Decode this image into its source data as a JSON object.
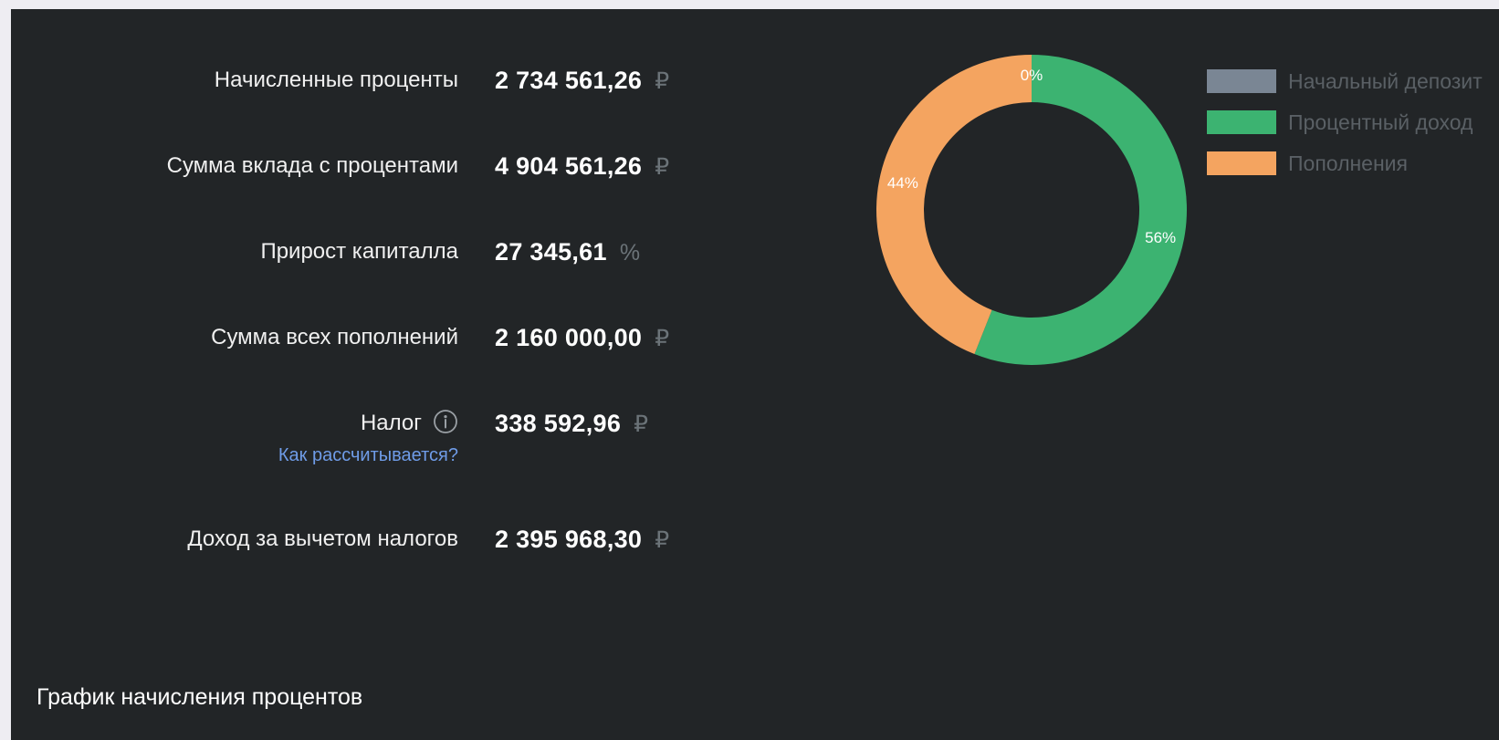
{
  "results": [
    {
      "label": "Начисленные проценты",
      "value": "2 734 561,26",
      "unit": "₽"
    },
    {
      "label": "Сумма вклада с процентами",
      "value": "4 904 561,26",
      "unit": "₽"
    },
    {
      "label": "Прирост капиталла",
      "value": "27 345,61",
      "unit": "%"
    },
    {
      "label": "Сумма всех пополнений",
      "value": "2 160 000,00",
      "unit": "₽"
    },
    {
      "label": "Налог",
      "value": "338 592,96",
      "unit": "₽",
      "link": "Как рассчитывается?"
    },
    {
      "label": "Доход за вычетом налогов",
      "value": "2 395 968,30",
      "unit": "₽"
    }
  ],
  "chart_data": {
    "type": "pie",
    "categories": [
      "Начальный депозит",
      "Процентный доход",
      "Пополнения"
    ],
    "values": [
      0,
      56,
      44
    ],
    "data_labels": [
      "0%",
      "56%",
      "44%"
    ],
    "colors": [
      "#7a8694",
      "#3cb371",
      "#f4a460"
    ],
    "legend_position": "right"
  },
  "section_title": "График начисления процентов",
  "icons": {
    "tax_info": "info-icon"
  }
}
